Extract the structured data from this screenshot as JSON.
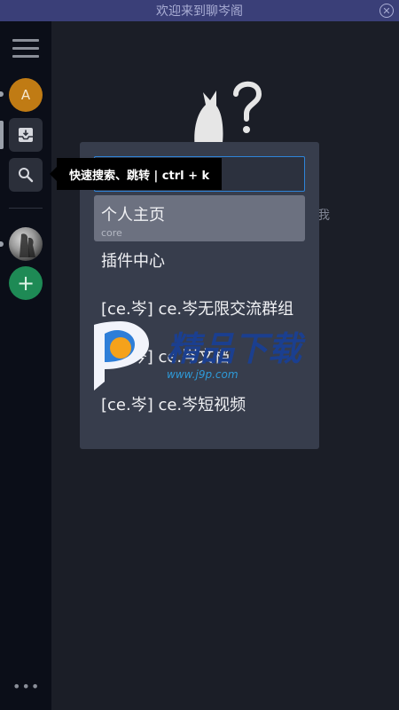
{
  "window": {
    "title": "欢迎来到聊岑阁"
  },
  "sidebar": {
    "avatar_letter": "A",
    "more_label": "•••"
  },
  "main": {
    "partial_text": "我"
  },
  "tooltip": {
    "text": "快速搜索、跳转 | ctrl + k"
  },
  "switcher": {
    "search_value": "",
    "items": [
      {
        "label": "个人主页",
        "sub": "core"
      },
      {
        "label": "插件中心"
      },
      {
        "label": "[ce.岑] ce.岑无限交流群组"
      },
      {
        "label": "[ce.岑] ce.岑文档"
      },
      {
        "label": "[ce.岑] ce.岑短视频"
      }
    ]
  },
  "watermark": {
    "brand": "精品下载",
    "url": "www.j9p.com"
  },
  "colors": {
    "titlebar": "#3a3f78",
    "sidebar": "#0b0e18",
    "main": "#1b1e27",
    "switcher": "#373d4c",
    "input_border": "#2e84d8",
    "avatar_orange": "#c07b14",
    "add_green": "#1e8a55"
  },
  "icons": [
    "close-icon",
    "menu-icon",
    "inbox-icon",
    "search-icon",
    "plus-icon",
    "more-icon"
  ]
}
